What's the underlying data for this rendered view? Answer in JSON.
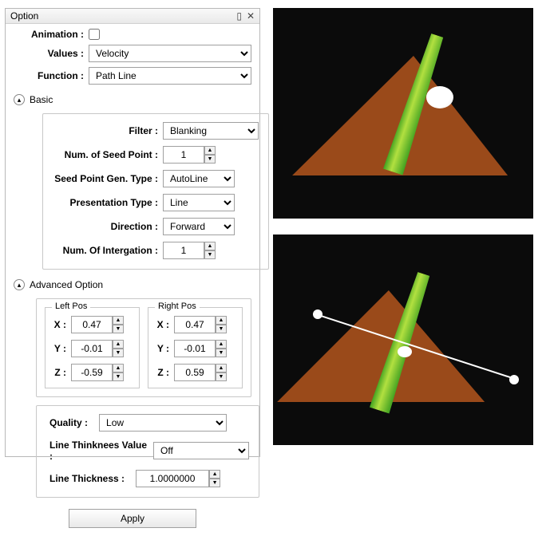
{
  "panel": {
    "title": "Option",
    "animation_label": "Animation :",
    "values_label": "Values :",
    "values_value": "Velocity",
    "function_label": "Function :",
    "function_value": "Path Line"
  },
  "basic": {
    "head": "Basic",
    "filter_label": "Filter :",
    "filter_value": "Blanking",
    "num_seed_label": "Num. of Seed Point :",
    "num_seed_value": "1",
    "seed_gen_label": "Seed Point Gen. Type :",
    "seed_gen_value": "AutoLine",
    "presentation_label": "Presentation Type :",
    "presentation_value": "Line",
    "direction_label": "Direction :",
    "direction_value": "Forward",
    "num_int_label": "Num. Of Intergation :",
    "num_int_value": "1"
  },
  "advanced": {
    "head": "Advanced Option",
    "left_legend": "Left Pos",
    "right_legend": "Right Pos",
    "x_label": "X :",
    "y_label": "Y :",
    "z_label": "Z :",
    "left_x": "0.47",
    "left_y": "-0.01",
    "left_z": "-0.59",
    "right_x": "0.47",
    "right_y": "-0.01",
    "right_z": "0.59",
    "quality_label": "Quality :",
    "quality_value": "Low",
    "thickness_value_label": "Line Thinknees Value :",
    "thickness_value": "Off",
    "thickness_label": "Line Thickness :",
    "thickness_num": "1.0000000"
  },
  "apply_label": "Apply"
}
